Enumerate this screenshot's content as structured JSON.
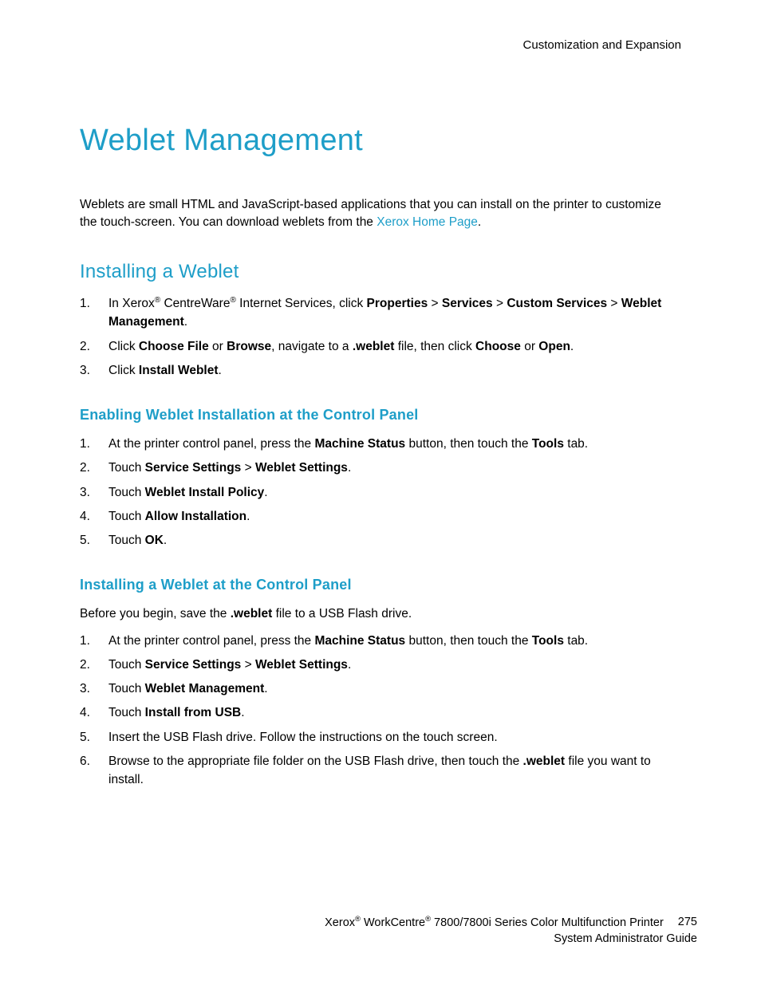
{
  "header": {
    "section": "Customization and Expansion"
  },
  "title": "Weblet Management",
  "intro": {
    "pre": "Weblets are small HTML and JavaScript-based applications that you can install on the printer to customize the touch-screen. You can download weblets from the ",
    "link": "Xerox Home Page",
    "post": "."
  },
  "section1": {
    "heading": "Installing a Weblet",
    "steps": [
      {
        "pre": "In Xerox",
        "sup1": "®",
        "mid1": " CentreWare",
        "sup2": "®",
        "mid2": " Internet Services, click ",
        "b1": "Properties",
        "t1": " > ",
        "b2": "Services",
        "t2": " > ",
        "b3": "Custom Services",
        "t3": " > ",
        "b4": "Weblet Management",
        "post": "."
      },
      {
        "pre": "Click ",
        "b1": "Choose File",
        "t1": " or ",
        "b2": "Browse",
        "t2": ", navigate to a ",
        "b3": ".weblet",
        "t3": " file, then click ",
        "b4": "Choose",
        "t4": " or ",
        "b5": "Open",
        "post": "."
      },
      {
        "pre": "Click ",
        "b1": "Install Weblet",
        "post": "."
      }
    ]
  },
  "section2": {
    "heading": "Enabling Weblet Installation at the Control Panel",
    "steps": [
      {
        "pre": "At the printer control panel, press the ",
        "b1": "Machine Status",
        "t1": " button, then touch the ",
        "b2": "Tools",
        "post": " tab."
      },
      {
        "pre": "Touch ",
        "b1": "Service Settings",
        "t1": " > ",
        "b2": "Weblet Settings",
        "post": "."
      },
      {
        "pre": "Touch ",
        "b1": "Weblet Install Policy",
        "post": "."
      },
      {
        "pre": "Touch ",
        "b1": "Allow Installation",
        "post": "."
      },
      {
        "pre": "Touch ",
        "b1": "OK",
        "post": "."
      }
    ]
  },
  "section3": {
    "heading": "Installing a Weblet at the Control Panel",
    "before": {
      "pre": "Before you begin, save the ",
      "b1": ".weblet",
      "post": " file to a USB Flash drive."
    },
    "steps": [
      {
        "pre": "At the printer control panel, press the ",
        "b1": "Machine Status",
        "t1": " button, then touch the ",
        "b2": "Tools",
        "post": " tab."
      },
      {
        "pre": "Touch ",
        "b1": "Service Settings",
        "t1": " > ",
        "b2": "Weblet Settings",
        "post": "."
      },
      {
        "pre": "Touch ",
        "b1": "Weblet Management",
        "post": "."
      },
      {
        "pre": "Touch ",
        "b1": "Install from USB",
        "post": "."
      },
      {
        "pre": "Insert the USB Flash drive. Follow the instructions on the touch screen.",
        "post": ""
      },
      {
        "pre": "Browse to the appropriate file folder on the USB Flash drive, then touch the ",
        "b1": ".weblet",
        "post": " file you want to install."
      }
    ]
  },
  "footer": {
    "brand1": "Xerox",
    "sup1": "®",
    "brand2": " WorkCentre",
    "sup2": "®",
    "product": " 7800/7800i Series Color Multifunction Printer",
    "pagenum": "275",
    "line2": "System Administrator Guide"
  }
}
